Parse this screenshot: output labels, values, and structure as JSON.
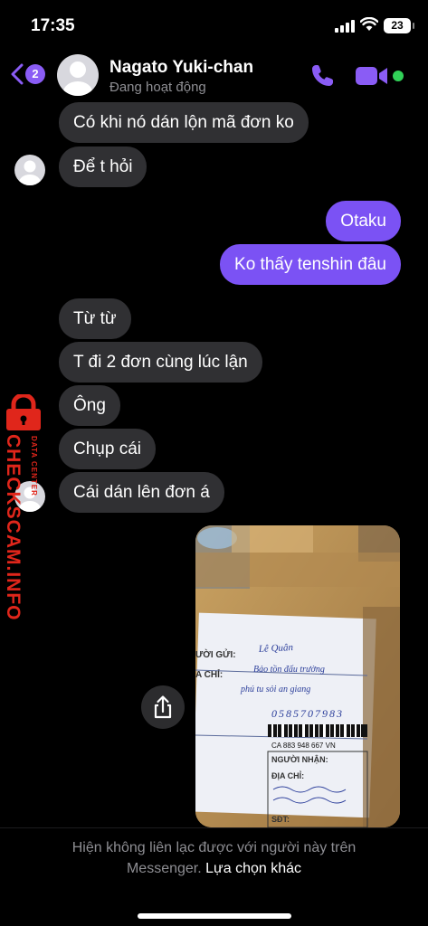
{
  "status_bar": {
    "time": "17:35",
    "battery": "23"
  },
  "header": {
    "unread_count": "2",
    "contact_name": "Nagato Yuki-chan",
    "contact_status": "Đang hoạt động",
    "accent_color": "#8a5cf5"
  },
  "messages": [
    {
      "direction": "in",
      "text": "Có khi nó dán lộn mã đơn ko"
    },
    {
      "direction": "in",
      "text": "Để t hỏi"
    },
    {
      "direction": "out",
      "text": "Otaku"
    },
    {
      "direction": "out",
      "text": "Ko thấy tenshin đâu"
    },
    {
      "direction": "in",
      "text": "Từ từ"
    },
    {
      "direction": "in",
      "text": "T đi 2 đơn cùng lúc lận"
    },
    {
      "direction": "in",
      "text": "Ông"
    },
    {
      "direction": "in",
      "text": "Chụp cái"
    },
    {
      "direction": "in",
      "text": "Cái dán lên đơn á"
    }
  ],
  "photo": {
    "label_sender": "ƯỜI GỬI:",
    "label_address": "A CHỈ:",
    "sender_name": "Lê Quân",
    "sender_addr1": "Bảo tồn đấu trường",
    "sender_addr2": "phú tu sỏi an giang",
    "sender_phone": "0585707983",
    "tracking": "CA 883 948 667 VN",
    "label_receiver": "NGƯỜI NHẬN:",
    "label_recv_addr": "ĐỊA CHỈ:",
    "label_phone": "SĐT:"
  },
  "footer": {
    "notice_line1": "Hiện không liên lạc được với người này trên",
    "notice_line2": "Messenger.",
    "notice_link": "Lựa chọn khác"
  },
  "watermark": {
    "brand": "CHECKSCAM.INFO",
    "tagline": "DATA CENTER"
  }
}
